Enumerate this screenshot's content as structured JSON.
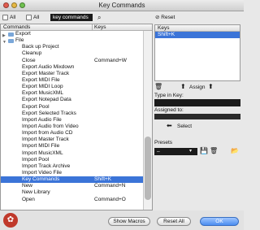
{
  "window": {
    "title": "Key Commands"
  },
  "toolbar": {
    "all_left": "All",
    "all_right": "All",
    "search_value": "key commands",
    "search_icon": "magnifier-icon"
  },
  "columns": {
    "commands": "Commands",
    "keys": "Keys"
  },
  "rows": [
    {
      "command": "Export",
      "key": "",
      "type": "folder"
    },
    {
      "command": "File",
      "key": "",
      "type": "folder"
    },
    {
      "command": "Back up Project",
      "key": ""
    },
    {
      "command": "Cleanup",
      "key": ""
    },
    {
      "command": "Close",
      "key": "Command+W"
    },
    {
      "command": "Export Audio Mixdown",
      "key": ""
    },
    {
      "command": "Export Master Track",
      "key": ""
    },
    {
      "command": "Export MIDI File",
      "key": ""
    },
    {
      "command": "Export MIDI Loop",
      "key": ""
    },
    {
      "command": "Export MusicXML",
      "key": ""
    },
    {
      "command": "Export Notepad Data",
      "key": ""
    },
    {
      "command": "Export Pool",
      "key": ""
    },
    {
      "command": "Export Selected Tracks",
      "key": ""
    },
    {
      "command": "Import Audio File",
      "key": ""
    },
    {
      "command": "Import Audio from Video",
      "key": ""
    },
    {
      "command": "Import from Audio CD",
      "key": ""
    },
    {
      "command": "Import Master Track",
      "key": ""
    },
    {
      "command": "Import MIDI File",
      "key": ""
    },
    {
      "command": "Import MusicXML",
      "key": ""
    },
    {
      "command": "Import Pool",
      "key": ""
    },
    {
      "command": "Import Track Archive",
      "key": ""
    },
    {
      "command": "Import Video File",
      "key": ""
    },
    {
      "command": "Key Commands",
      "key": "Shift+K",
      "selected": true
    },
    {
      "command": "New",
      "key": "Command+N"
    },
    {
      "command": "New Library",
      "key": ""
    },
    {
      "command": "Open",
      "key": "Command+O"
    }
  ],
  "right_panel": {
    "reset_label": "Reset",
    "keys_header": "Keys",
    "selected_key": "Shift+K",
    "assign_label": "Assign",
    "type_in_key_label": "Type in Key:",
    "assigned_to_label": "Assigned to:",
    "select_label": "Select",
    "presets_label": "Presets",
    "preset_value": "–"
  },
  "buttons": {
    "show_macros": "Show Macros",
    "reset_all": "Reset All",
    "ok": "OK"
  },
  "colors": {
    "selection": "#3b74d8",
    "dark_field": "#1b1b1b"
  }
}
